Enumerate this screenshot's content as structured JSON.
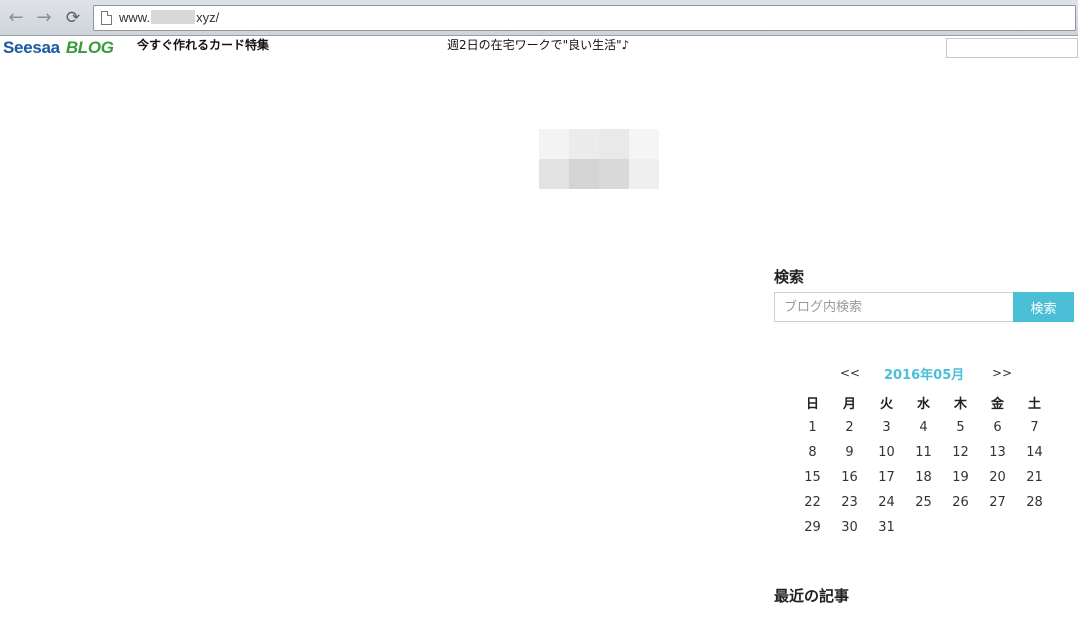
{
  "browser": {
    "url_prefix": "www.",
    "url_suffix": "xyz/",
    "back_icon": "arrow-left",
    "forward_icon": "arrow-right",
    "reload_icon": "reload"
  },
  "header": {
    "logo_main": "Seesaa",
    "logo_blog": "BLOG",
    "link_1": "今すぐ作れるカード特集",
    "link_2": "週2日の在宅ワークで\"良い生活\"♪",
    "search_value": ""
  },
  "mosaic_colors": [
    "#f3f3f3",
    "#ececec",
    "#e9e9e9",
    "#f5f5f5",
    "#e3e3e3",
    "#d4d4d4",
    "#d9d9d9",
    "#efefef"
  ],
  "sidebar": {
    "search_title": "検索",
    "search_placeholder": "ブログ内検索",
    "search_button": "検索",
    "calendar": {
      "prev": "<<",
      "title": "2016年05月",
      "next": ">>",
      "weekdays": [
        "日",
        "月",
        "火",
        "水",
        "木",
        "金",
        "土"
      ],
      "weeks": [
        [
          "1",
          "2",
          "3",
          "4",
          "5",
          "6",
          "7"
        ],
        [
          "8",
          "9",
          "10",
          "11",
          "12",
          "13",
          "14"
        ],
        [
          "15",
          "16",
          "17",
          "18",
          "19",
          "20",
          "21"
        ],
        [
          "22",
          "23",
          "24",
          "25",
          "26",
          "27",
          "28"
        ],
        [
          "29",
          "30",
          "31",
          "",
          "",
          "",
          ""
        ]
      ]
    },
    "recent_title": "最近の記事"
  },
  "colors": {
    "accent": "#4bbfd6",
    "logo_blue": "#1b5aa0",
    "logo_green": "#3a9a3c"
  }
}
